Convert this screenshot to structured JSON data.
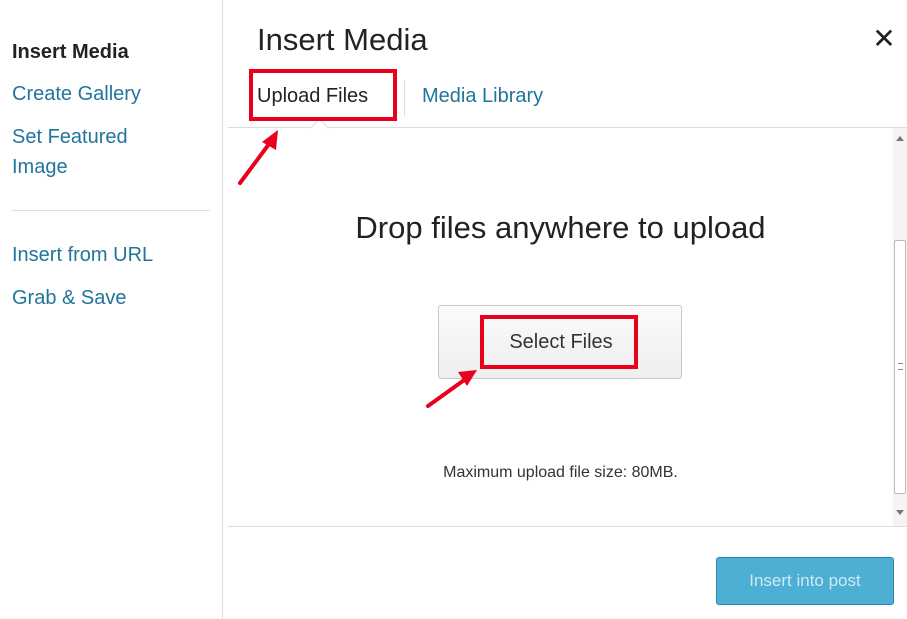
{
  "sidebar": {
    "title": "Insert Media",
    "items": [
      {
        "label": "Create Gallery"
      },
      {
        "label": "Set Featured"
      },
      {
        "label": "Image"
      },
      {
        "label": "Insert from URL"
      },
      {
        "label": "Grab & Save"
      }
    ]
  },
  "modal": {
    "title": "Insert Media",
    "close_icon": "close-icon",
    "tabs": [
      {
        "label": "Upload Files",
        "active": true
      },
      {
        "label": "Media Library",
        "active": false
      }
    ]
  },
  "upload": {
    "drop_text": "Drop files anywhere to upload",
    "select_button": "Select Files",
    "max_size_text": "Maximum upload file size: 80MB."
  },
  "footer": {
    "insert_button": "Insert into post",
    "insert_enabled": false
  },
  "colors": {
    "link": "#21759b",
    "text": "#222222",
    "highlight": "#e8001c",
    "primary_button": "#2ea2cc"
  }
}
